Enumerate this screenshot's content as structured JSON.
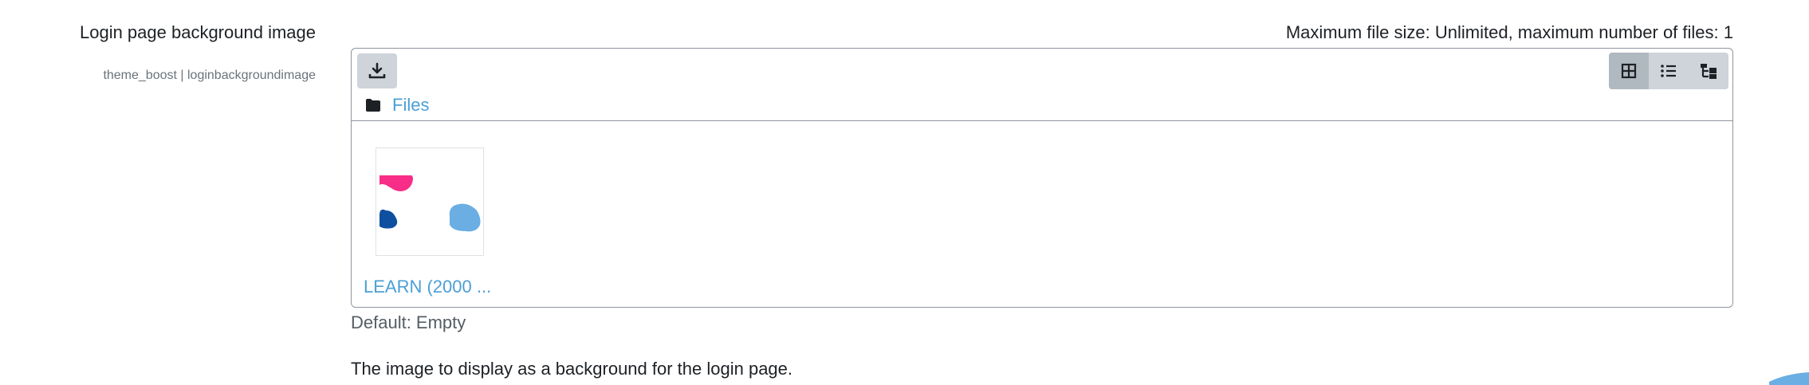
{
  "setting": {
    "label": "Login page background image",
    "sublabel": "theme_boost | loginbackgroundimage"
  },
  "filemanager": {
    "max_info": "Maximum file size: Unlimited, maximum number of files: 1",
    "path_label": "Files",
    "download_icon": "download-icon",
    "view_icons": [
      "grid-icon",
      "list-icon",
      "tree-icon"
    ],
    "active_view": "grid",
    "files": [
      {
        "name": "LEARN (2000 ..."
      }
    ]
  },
  "default_value": "Default: Empty",
  "description": "The image to display as a background for the login page.",
  "colors": {
    "link": "#4a9fd6",
    "thumb_pink": "#f72d87",
    "thumb_darkblue": "#0f4fa0",
    "thumb_lightblue": "#6aaee3"
  }
}
